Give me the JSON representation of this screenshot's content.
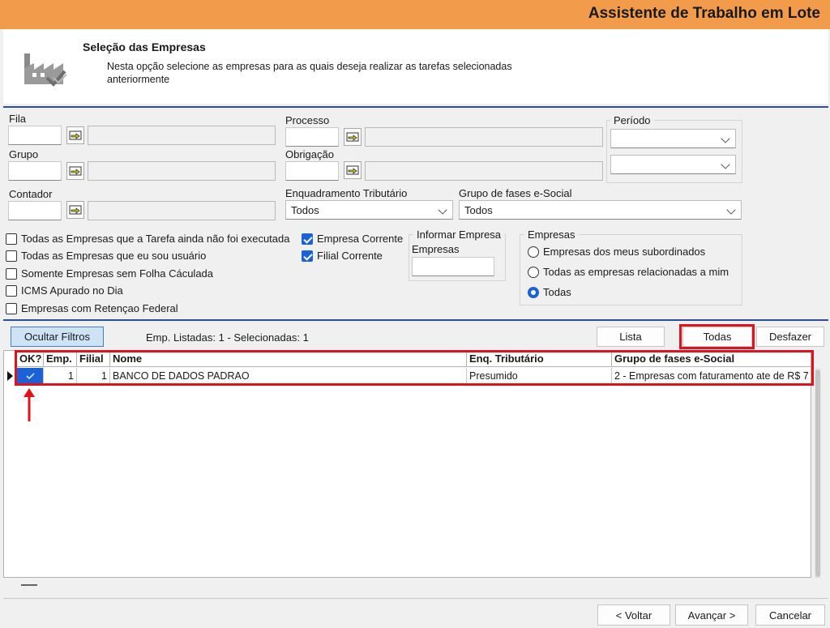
{
  "window": {
    "title": "Assistente de Trabalho em Lote"
  },
  "header": {
    "title": "Seleção das Empresas",
    "description": "Nesta opção selecione as empresas para as quais deseja realizar as tarefas selecionadas anteriormente",
    "icon": "factory-check-icon"
  },
  "filters": {
    "fila": {
      "label": "Fila",
      "value": "",
      "description": ""
    },
    "grupo": {
      "label": "Grupo",
      "value": "",
      "description": ""
    },
    "contador": {
      "label": "Contador",
      "value": "",
      "description": ""
    },
    "processo": {
      "label": "Processo",
      "value": "",
      "description": ""
    },
    "obrigacao": {
      "label": "Obrigação",
      "value": "",
      "description": ""
    },
    "periodo": {
      "label": "Período",
      "value1": "",
      "value2": ""
    },
    "enquadramento": {
      "label": "Enquadramento Tributário",
      "value": "Todos"
    },
    "grupo_fases": {
      "label": "Grupo de fases e-Social",
      "value": "Todos"
    }
  },
  "checkboxes": [
    {
      "label": "Todas as Empresas que a Tarefa ainda não foi executada",
      "checked": false
    },
    {
      "label": "Todas as Empresas que eu sou usuário",
      "checked": false
    },
    {
      "label": "Somente Empresas sem Folha Cáculada",
      "checked": false
    },
    {
      "label": "ICMS Apurado no Dia",
      "checked": false
    },
    {
      "label": "Empresas com Retençao Federal",
      "checked": false
    }
  ],
  "checkboxes_right": [
    {
      "label": "Empresa Corrente",
      "checked": true
    },
    {
      "label": "Filial Corrente",
      "checked": true
    }
  ],
  "informar": {
    "title": "Informar Empresa",
    "label": "Empresas",
    "value": ""
  },
  "empresas_group": {
    "title": "Empresas",
    "options": [
      {
        "label": "Empresas dos meus subordinados",
        "selected": false
      },
      {
        "label": "Todas as empresas relacionadas a mim",
        "selected": false
      },
      {
        "label": "Todas",
        "selected": true
      }
    ]
  },
  "toolbar": {
    "ocultar_label": "Ocultar Filtros",
    "status": "Emp. Listadas: 1 - Selecionadas: 1",
    "lista_label": "Lista",
    "todas_label": "Todas",
    "desfazer_label": "Desfazer"
  },
  "grid": {
    "columns": [
      "OK?",
      "Emp.",
      "Filial",
      "Nome",
      "Enq. Tributário",
      "Grupo de fases e-Social"
    ],
    "rows": [
      {
        "ok": true,
        "emp": "1",
        "filial": "1",
        "nome": "BANCO DE DADOS PADRAO",
        "enq": "Presumido",
        "grupo": "2 - Empresas com faturamento ate de R$ 7"
      }
    ]
  },
  "footer": {
    "voltar_label": "< Voltar",
    "avancar_label": "Avançar >",
    "cancelar_label": "Cancelar"
  },
  "colors": {
    "titlebar": "#f29b4b",
    "accent": "#1a62d6",
    "highlight": "#e0121b",
    "separator": "#2b4ea0"
  }
}
